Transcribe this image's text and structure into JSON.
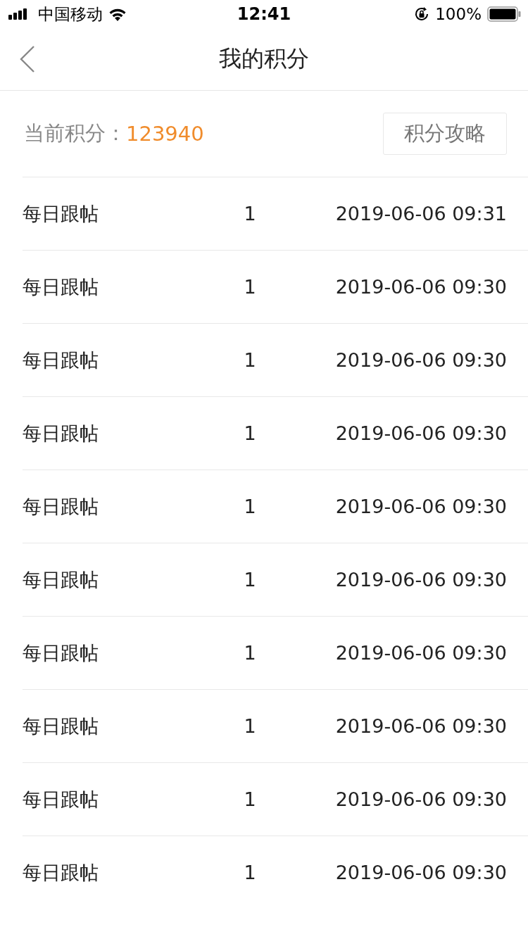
{
  "status_bar": {
    "carrier": "中国移动",
    "time": "12:41",
    "battery": "100%"
  },
  "nav": {
    "title": "我的积分"
  },
  "summary": {
    "label": "当前积分：",
    "points": "123940",
    "guide_button": "积分攻略"
  },
  "records": [
    {
      "name": "每日跟帖",
      "points": "1",
      "time": "2019-06-06 09:31"
    },
    {
      "name": "每日跟帖",
      "points": "1",
      "time": "2019-06-06 09:30"
    },
    {
      "name": "每日跟帖",
      "points": "1",
      "time": "2019-06-06 09:30"
    },
    {
      "name": "每日跟帖",
      "points": "1",
      "time": "2019-06-06 09:30"
    },
    {
      "name": "每日跟帖",
      "points": "1",
      "time": "2019-06-06 09:30"
    },
    {
      "name": "每日跟帖",
      "points": "1",
      "time": "2019-06-06 09:30"
    },
    {
      "name": "每日跟帖",
      "points": "1",
      "time": "2019-06-06 09:30"
    },
    {
      "name": "每日跟帖",
      "points": "1",
      "time": "2019-06-06 09:30"
    },
    {
      "name": "每日跟帖",
      "points": "1",
      "time": "2019-06-06 09:30"
    },
    {
      "name": "每日跟帖",
      "points": "1",
      "time": "2019-06-06 09:30"
    }
  ]
}
